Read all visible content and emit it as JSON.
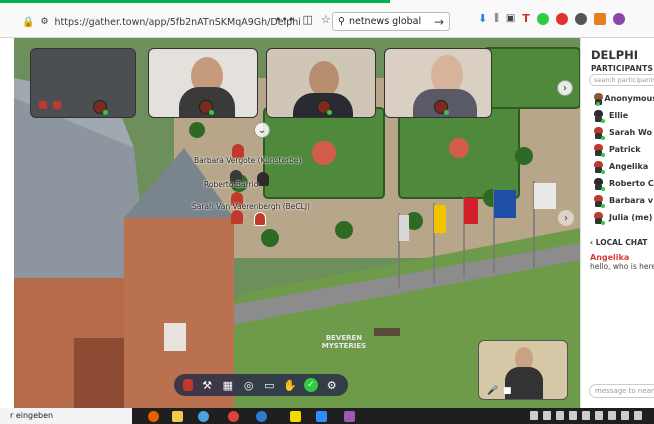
{
  "browser": {
    "url": "https://gather.town/app/5fb2nATnSKMqA9Gh/Delphi",
    "search_text": "netnews global",
    "menu_dots": "•••"
  },
  "map": {
    "name_labels": [
      "Barbara Vergote (Kunsterbe)",
      "Roberto Barrio",
      "Sarah Van Vaerenbergh (BeCLJ)"
    ],
    "floor_text": "BEVEREN MYSTERIES"
  },
  "sidebar": {
    "title": "DELPHI",
    "participants_heading": "PARTICIPANTS",
    "search_placeholder": "search participants",
    "participants": [
      {
        "name": "Anonymous",
        "head_color": "#8a5a2a"
      },
      {
        "name": "Ellie",
        "head_color": "#2b2b2b"
      },
      {
        "name": "Sarah Wo",
        "head_color": "#c0392b"
      },
      {
        "name": "Patrick",
        "head_color": "#c0392b"
      },
      {
        "name": "Angelika",
        "head_color": "#c0392b"
      },
      {
        "name": "Roberto C",
        "head_color": "#2b2b2b"
      },
      {
        "name": "Barbara v",
        "head_color": "#c0392b"
      },
      {
        "name": "Julia (me)",
        "head_color": "#c0392b"
      }
    ],
    "local_chat_heading": "LOCAL CHAT",
    "chat_messages": [
      {
        "author": "Angelika",
        "text": "hello, who is here"
      }
    ],
    "message_placeholder": "message to nearby"
  },
  "taskbar": {
    "search_text": "r eingeben"
  },
  "colors": {
    "accent_green": "#00b050",
    "status_online": "#2ecc40",
    "chat_author": "#d93b3b"
  }
}
